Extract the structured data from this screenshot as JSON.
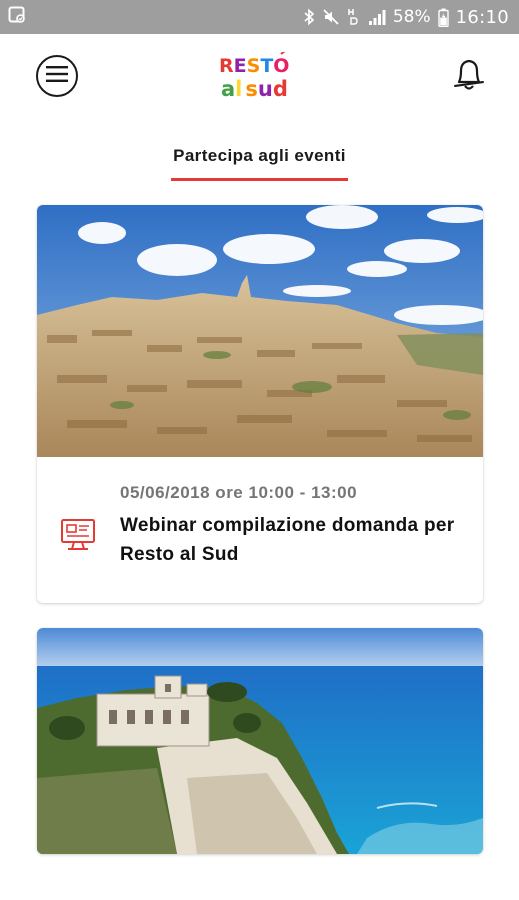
{
  "status_bar": {
    "battery_percent": "58%",
    "time": "16:10",
    "icons": [
      "screenshot-notification-icon",
      "bluetooth-icon",
      "mute-icon",
      "hd-signal-icon",
      "signal-icon",
      "battery-icon"
    ]
  },
  "header": {
    "logo": {
      "line1": "RESTO",
      "line2": "al sud"
    },
    "icons": [
      "hamburger-menu-icon",
      "bell-icon"
    ]
  },
  "tabs": [
    {
      "label": "Partecipa agli eventi",
      "active": true
    }
  ],
  "events": [
    {
      "image": "matera-city-photo",
      "datetime": "05/06/2018 ore 10:00 - 13:00",
      "title": "Webinar compilazione domanda per Resto al Sud",
      "icon": "webinar-icon"
    },
    {
      "image": "tropea-coast-photo"
    }
  ],
  "colors": {
    "accent": "#e53935",
    "status_bar_bg": "#9e9e9e",
    "date_text": "#757575"
  }
}
